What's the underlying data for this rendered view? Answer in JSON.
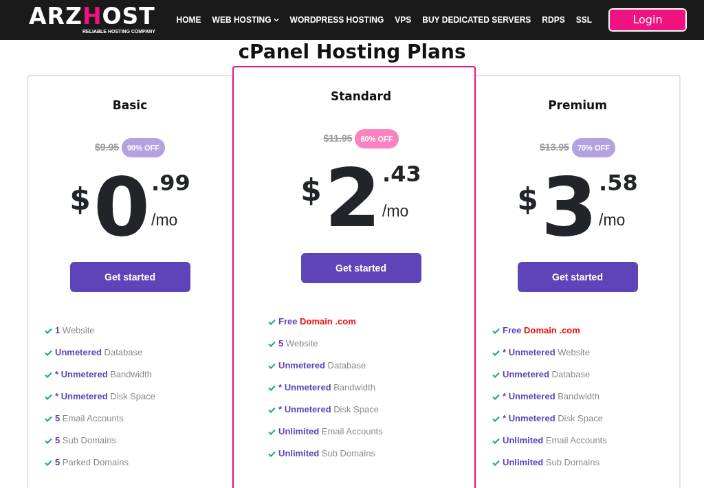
{
  "header": {
    "logo": {
      "parts": [
        {
          "text": "ARZ",
          "accent": false
        },
        {
          "text": "H",
          "accent": true
        },
        {
          "text": "OST",
          "accent": false
        }
      ],
      "tagline": "RELIABLE HOSTING COMPANY"
    },
    "nav": [
      {
        "label": "HOME",
        "dropdown": false
      },
      {
        "label": "WEB HOSTING",
        "dropdown": true
      },
      {
        "label": "WORDPRESS HOSTING",
        "dropdown": false
      },
      {
        "label": "VPS",
        "dropdown": false
      },
      {
        "label": "BUY DEDICATED SERVERS",
        "dropdown": false
      },
      {
        "label": "RDPS",
        "dropdown": false
      },
      {
        "label": "SSL",
        "dropdown": false
      }
    ],
    "login": "Login"
  },
  "heading": [
    "cPanel Hosting Plans"
  ],
  "plans": [
    {
      "name": "Basic",
      "featured": false,
      "old_price": "$9.95",
      "badge": {
        "text": "90% OFF",
        "color": "#b3a2e0"
      },
      "currency": "$",
      "whole": "0",
      "cents": ".99",
      "period": "/mo",
      "button": "Get started",
      "features": [
        [
          {
            "text": "1",
            "kind": "strong"
          },
          {
            "text": "Website",
            "kind": "plain"
          }
        ],
        [
          {
            "text": "Unmetered",
            "kind": "strong"
          },
          {
            "text": "Database",
            "kind": "plain"
          }
        ],
        [
          {
            "text": "* Unmetered",
            "kind": "strong"
          },
          {
            "text": "Bandwidth",
            "kind": "plain"
          }
        ],
        [
          {
            "text": "* Unmetered",
            "kind": "strong"
          },
          {
            "text": "Disk Space",
            "kind": "plain"
          }
        ],
        [
          {
            "text": "5",
            "kind": "strong"
          },
          {
            "text": "Email Accounts",
            "kind": "plain"
          }
        ],
        [
          {
            "text": "5",
            "kind": "strong"
          },
          {
            "text": "Sub Domains",
            "kind": "plain"
          }
        ],
        [
          {
            "text": "5",
            "kind": "strong"
          },
          {
            "text": "Parked Domains",
            "kind": "plain"
          }
        ]
      ]
    },
    {
      "name": "Standard",
      "featured": true,
      "old_price": "$11.95",
      "badge": {
        "text": "80% OFF",
        "color": "#fa82bf"
      },
      "currency": "$",
      "whole": "2",
      "cents": ".43",
      "period": "/mo",
      "button": "Get started",
      "features": [
        [
          {
            "text": "Free",
            "kind": "strong"
          },
          {
            "text": "Domain .com",
            "kind": "highlight"
          }
        ],
        [
          {
            "text": "5",
            "kind": "strong"
          },
          {
            "text": "Website",
            "kind": "plain"
          }
        ],
        [
          {
            "text": "Unmetered",
            "kind": "strong"
          },
          {
            "text": "Database",
            "kind": "plain"
          }
        ],
        [
          {
            "text": "* Unmetered",
            "kind": "strong"
          },
          {
            "text": "Bandwidth",
            "kind": "plain"
          }
        ],
        [
          {
            "text": "* Unmetered",
            "kind": "strong"
          },
          {
            "text": "Disk Space",
            "kind": "plain"
          }
        ],
        [
          {
            "text": "Unlimited",
            "kind": "strong"
          },
          {
            "text": "Email Accounts",
            "kind": "plain"
          }
        ],
        [
          {
            "text": "Unlimited",
            "kind": "strong"
          },
          {
            "text": "Sub Domains",
            "kind": "plain"
          }
        ]
      ]
    },
    {
      "name": "Premium",
      "featured": false,
      "old_price": "$13.95",
      "badge": {
        "text": "70% OFF",
        "color": "#b3a2e0"
      },
      "currency": "$",
      "whole": "3",
      "cents": ".58",
      "period": "/mo",
      "button": "Get started",
      "features": [
        [
          {
            "text": "Free",
            "kind": "strong"
          },
          {
            "text": "Domain .com",
            "kind": "highlight"
          }
        ],
        [
          {
            "text": "* Unmetered",
            "kind": "strong"
          },
          {
            "text": "Website",
            "kind": "plain"
          }
        ],
        [
          {
            "text": "Unmetered",
            "kind": "strong"
          },
          {
            "text": "Database",
            "kind": "plain"
          }
        ],
        [
          {
            "text": "* Unmetered",
            "kind": "strong"
          },
          {
            "text": "Bandwidth",
            "kind": "plain"
          }
        ],
        [
          {
            "text": "* Unmetered",
            "kind": "strong"
          },
          {
            "text": "Disk Space",
            "kind": "plain"
          }
        ],
        [
          {
            "text": "Unlimited",
            "kind": "strong"
          },
          {
            "text": "Email Accounts",
            "kind": "plain"
          }
        ],
        [
          {
            "text": "Unlimited",
            "kind": "strong"
          },
          {
            "text": "Sub Domains",
            "kind": "plain"
          }
        ]
      ]
    }
  ]
}
